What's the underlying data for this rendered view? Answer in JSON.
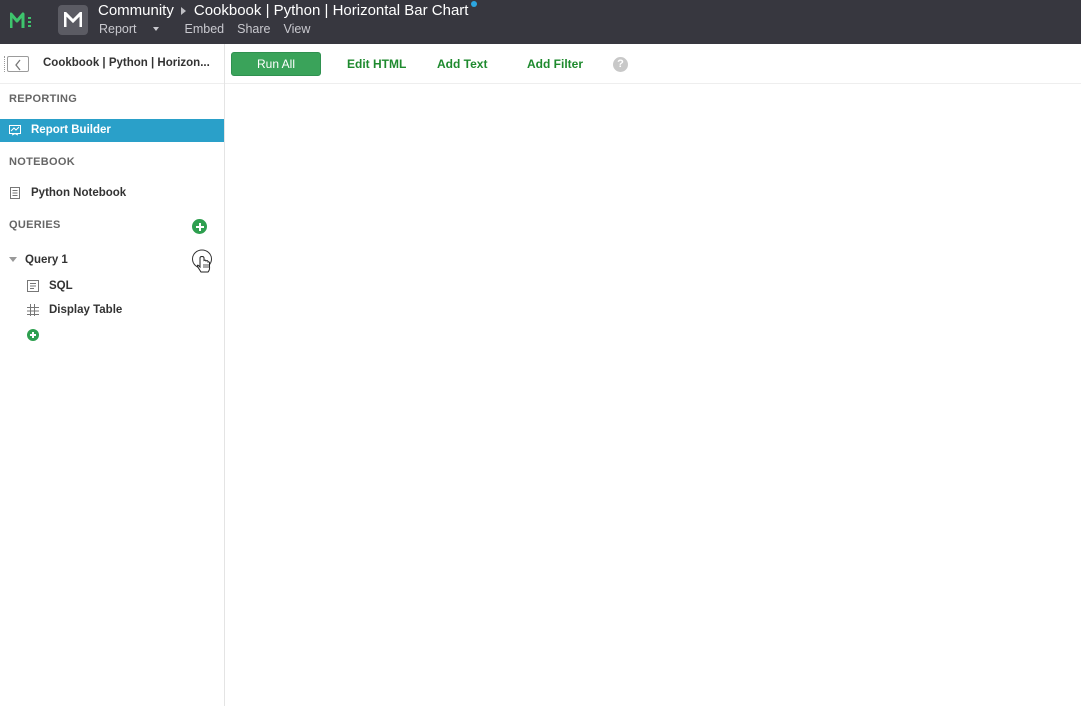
{
  "topbar": {
    "breadcrumb_root": "Community",
    "report_title": "Cookbook | Python | Horizontal Bar Chart",
    "menu": [
      "Report",
      "Embed",
      "Share",
      "View"
    ]
  },
  "sidebar": {
    "header_title": "Cookbook | Python | Horizon...",
    "reporting_label": "REPORTING",
    "report_builder": "Report Builder",
    "notebook_label": "NOTEBOOK",
    "python_notebook": "Python Notebook",
    "queries_label": "QUERIES",
    "query_name": "Query 1",
    "query_items": [
      "SQL",
      "Display Table"
    ]
  },
  "toolbar": {
    "run_all": "Run All",
    "edit_html": "Edit HTML",
    "add_text": "Add Text",
    "add_filter": "Add Filter",
    "help": "?"
  },
  "colors": {
    "topbar_bg": "#37373f",
    "active_item": "#2aa0c9",
    "primary_green": "#3aa35a",
    "link_green": "#1e8a2e",
    "unsaved_dot": "#2ca6e0"
  }
}
